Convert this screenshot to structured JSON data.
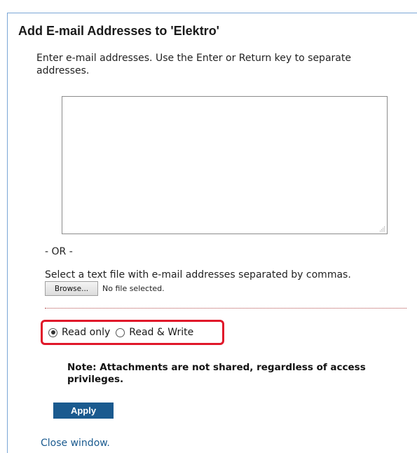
{
  "dialog": {
    "title": "Add E-mail Addresses to 'Elektro'",
    "instructions": "Enter e-mail addresses. Use the Enter or Return key to separate addresses.",
    "email_textarea": {
      "value": "",
      "placeholder": ""
    },
    "or_text": "- OR -",
    "file_instructions": "Select a text file with e-mail addresses separated by commas.",
    "browse_label": "Browse...",
    "file_status": "No file selected.",
    "access_options": [
      {
        "label": "Read only",
        "selected": true
      },
      {
        "label": "Read & Write",
        "selected": false
      }
    ],
    "note": "Note: Attachments are not shared, regardless of access privileges.",
    "apply_label": "Apply",
    "close_label": "Close window."
  },
  "colors": {
    "link": "#1a5a8f",
    "apply_button_bg": "#1a5a8f",
    "highlight_border": "#e0182a",
    "divider": "#b24a4a",
    "dialog_border": "#7aa6d6"
  },
  "icons": {
    "resize_grip": "resize-grip-icon"
  }
}
